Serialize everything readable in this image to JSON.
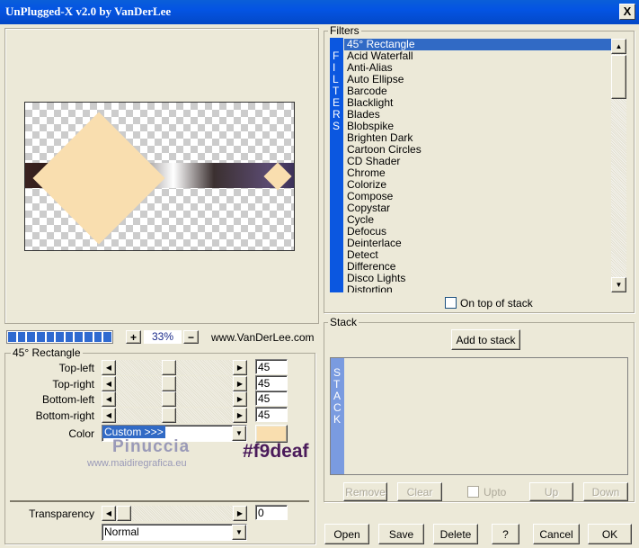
{
  "window": {
    "title": "UnPlugged-X v2.0 by VanDerLee",
    "close": "X"
  },
  "preview": {
    "zoom": "33%",
    "plus": "+",
    "minus": "−",
    "website": "www.VanDerLee.com",
    "progress_segments": 11
  },
  "params": {
    "group_title": "45° Rectangle",
    "sliders": [
      {
        "label": "Top-left",
        "value": "45"
      },
      {
        "label": "Top-right",
        "value": "45"
      },
      {
        "label": "Bottom-left",
        "value": "45"
      },
      {
        "label": "Bottom-right",
        "value": "45"
      }
    ],
    "color_label": "Color",
    "color_value": "Custom >>>",
    "color_swatch": "#f9deaf",
    "transparency_label": "Transparency",
    "transparency_value": "0",
    "blend_mode": "Normal"
  },
  "watermark": {
    "name": "Pinuccia",
    "site": "www.maidiregrafica.eu",
    "color_note": "#f9deaf"
  },
  "filters": {
    "group_title": "Filters",
    "strip": "FILTERS",
    "items": [
      "45° Rectangle",
      "Acid Waterfall",
      "Anti-Alias",
      "Auto Ellipse",
      "Barcode",
      "Blacklight",
      "Blades",
      "Blobspike",
      "Brighten Dark",
      "Cartoon Circles",
      "CD Shader",
      "Chrome",
      "Colorize",
      "Compose",
      "Copystar",
      "Cycle",
      "Defocus",
      "Deinterlace",
      "Detect",
      "Difference",
      "Disco Lights",
      "Distortion"
    ],
    "selected": "45° Rectangle",
    "on_top_label": "On top of stack"
  },
  "stack": {
    "group_title": "Stack",
    "add": "Add to stack",
    "strip": "STACK",
    "remove": "Remove",
    "clear": "Clear",
    "upto": "Upto",
    "up": "Up",
    "down": "Down"
  },
  "buttons": {
    "open": "Open",
    "save": "Save",
    "delete": "Delete",
    "help": "?",
    "cancel": "Cancel",
    "ok": "OK"
  }
}
